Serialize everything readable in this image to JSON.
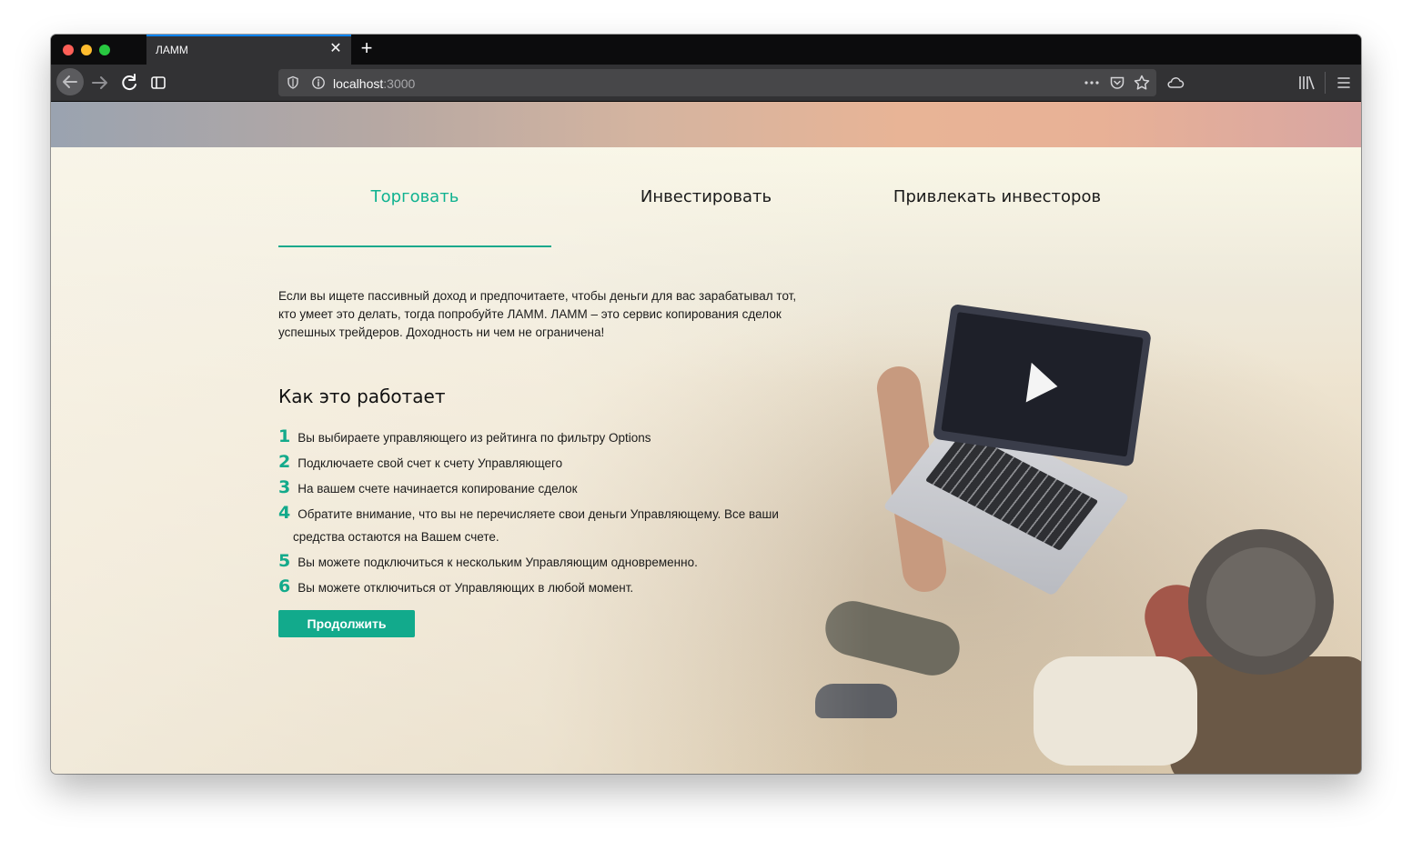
{
  "browser": {
    "tab_title": "ЛАММ",
    "tab_close_glyph": "✕",
    "new_tab_glyph": "+",
    "url_host": "localhost",
    "url_port": ":3000",
    "icons": [
      "back-icon",
      "forward-icon",
      "reload-icon",
      "sidebar-icon",
      "shield-icon",
      "info-icon",
      "more-icon",
      "pocket-icon",
      "star-icon",
      "cloud-icon",
      "library-icon",
      "menu-icon"
    ]
  },
  "nav": {
    "items": [
      {
        "label": "Торговать",
        "active": true
      },
      {
        "label": "Инвестировать",
        "active": false
      },
      {
        "label": "Привлекать инвесторов",
        "active": false
      }
    ]
  },
  "intro": "Если вы ищете пассивный доход и предпочитаете, чтобы деньги для вас зарабатывал тот, кто умеет это делать, тогда попробуйте ЛАММ. ЛАММ – это сервис копирования сделок успешных трейдеров. Доходность ни чем не ограничена!",
  "how": {
    "title": "Как это работает",
    "steps": [
      {
        "num": "1",
        "text": "Вы выбираете управляющего из рейтинга по фильтру Options"
      },
      {
        "num": "2",
        "text": "Подключаете свой счет к счету Управляющего"
      },
      {
        "num": "3",
        "text": "На вашем счете начинается копирование сделок"
      },
      {
        "num": "4",
        "text": "Обратите внимание, что вы не перечисляете свои деньги Управляющему. Все ваши средства остаются на Вашем счете."
      },
      {
        "num": "5",
        "text": "Вы можете подключиться к нескольким Управляющим одновременно."
      },
      {
        "num": "6",
        "text": "Вы можете отключиться от Управляющих в любой момент."
      }
    ]
  },
  "cta_label": "Продолжить",
  "colors": {
    "accent": "#12aa8c",
    "accent_text": "#0fb290"
  }
}
